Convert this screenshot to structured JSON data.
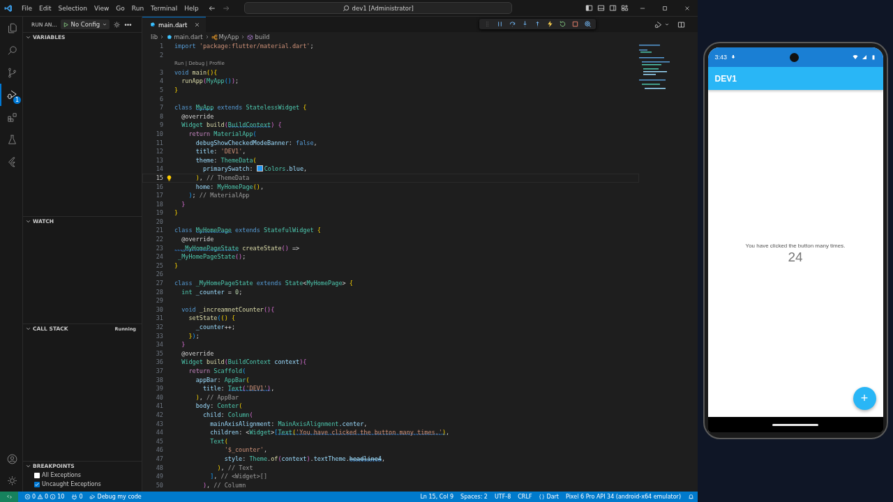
{
  "title_bar": {
    "menu": [
      "File",
      "Edit",
      "Selection",
      "View",
      "Go",
      "Run",
      "Terminal",
      "Help"
    ],
    "command_center": "dev1 [Administrator]"
  },
  "activity_bar": {
    "items": [
      {
        "kind": "explorer",
        "selected": false
      },
      {
        "kind": "search",
        "selected": false
      },
      {
        "kind": "source-control",
        "selected": false
      },
      {
        "kind": "debug",
        "selected": true,
        "badge": "1"
      },
      {
        "kind": "extensions",
        "selected": false
      },
      {
        "kind": "testing",
        "selected": false
      },
      {
        "kind": "flutter",
        "selected": false
      }
    ],
    "bottom": [
      {
        "kind": "account"
      },
      {
        "kind": "settings"
      }
    ]
  },
  "run_panel": {
    "title": "RUN AN...",
    "config": "No Config",
    "sections": [
      {
        "title": "VARIABLES",
        "expanded": true
      },
      {
        "title": "WATCH",
        "expanded": true
      },
      {
        "title": "CALL STACK",
        "expanded": true,
        "status": "Running"
      },
      {
        "title": "BREAKPOINTS",
        "expanded": true,
        "items": [
          {
            "label": "All Exceptions",
            "checked": false
          },
          {
            "label": "Uncaught Exceptions",
            "checked": true
          }
        ]
      }
    ]
  },
  "editor": {
    "tabs": [
      {
        "label": "main.dart",
        "selected": true
      }
    ],
    "breadcrumbs": [
      {
        "kind": "folder",
        "text": "lib"
      },
      {
        "kind": "file",
        "text": "main.dart"
      },
      {
        "kind": "class",
        "text": "MyApp"
      },
      {
        "kind": "method",
        "text": "build"
      }
    ],
    "lines": [
      {
        "n": "1",
        "current": false,
        "tokens": [
          {
            "text": "import ",
            "kind": "kw"
          },
          {
            "text": "'package:flutter/material.dart'",
            "kind": "str"
          },
          {
            "text": ";",
            "kind": "p"
          }
        ]
      },
      {
        "n": "2",
        "current": false
      },
      {
        "n": "3",
        "current": false,
        "codelens": "Run | Debug | Profile",
        "tokens": [
          {
            "text": "void ",
            "kind": "kw"
          },
          {
            "text": "main",
            "kind": "fn"
          },
          {
            "text": "(){",
            "kind": "b1"
          }
        ]
      },
      {
        "n": "4",
        "current": false,
        "tokens": [
          {
            "text": "  runApp",
            "kind": "fn"
          },
          {
            "text": "(",
            "kind": "b2"
          },
          {
            "text": "MyApp",
            "kind": "type"
          },
          {
            "text": "()",
            "kind": "b3"
          },
          {
            "text": ")",
            "kind": "b2"
          },
          {
            "text": ";",
            "kind": "p"
          }
        ]
      },
      {
        "n": "5",
        "current": false,
        "tokens": [
          {
            "text": "}",
            "kind": "b1"
          }
        ]
      },
      {
        "n": "6",
        "current": false
      },
      {
        "n": "7",
        "current": false,
        "tokens": [
          {
            "text": "class ",
            "kind": "kw"
          },
          {
            "text": "MyApp",
            "kind": "type",
            "squiggle": true
          },
          {
            "text": " extends ",
            "kind": "kw"
          },
          {
            "text": "StatelessWidget",
            "kind": "type"
          },
          {
            "text": " {",
            "kind": "b1"
          }
        ]
      },
      {
        "n": "8",
        "current": false,
        "tokens": [
          {
            "text": "  @override",
            "kind": "ann"
          }
        ]
      },
      {
        "n": "9",
        "current": false,
        "tokens": [
          {
            "text": "  Widget",
            "kind": "type"
          },
          {
            "text": " build",
            "kind": "fn"
          },
          {
            "text": "(",
            "kind": "b2"
          },
          {
            "text": "BuildContext",
            "kind": "type",
            "squiggle": true
          },
          {
            "text": ")",
            "kind": "b2"
          },
          {
            "text": " {",
            "kind": "b2"
          }
        ]
      },
      {
        "n": "10",
        "current": false,
        "tokens": [
          {
            "text": "    return ",
            "kind": "ctl"
          },
          {
            "text": "MaterialApp",
            "kind": "type"
          },
          {
            "text": "(",
            "kind": "b3"
          }
        ]
      },
      {
        "n": "11",
        "current": false,
        "tokens": [
          {
            "text": "      debugShowCheckedModeBanner",
            "kind": "var"
          },
          {
            "text": ": ",
            "kind": "p"
          },
          {
            "text": "false",
            "kind": "kw"
          },
          {
            "text": ",",
            "kind": "p"
          }
        ]
      },
      {
        "n": "12",
        "current": false,
        "tokens": [
          {
            "text": "      title",
            "kind": "var"
          },
          {
            "text": ": ",
            "kind": "p"
          },
          {
            "text": "'DEV1'",
            "kind": "str"
          },
          {
            "text": ",",
            "kind": "p"
          }
        ]
      },
      {
        "n": "13",
        "current": false,
        "tokens": [
          {
            "text": "      theme",
            "kind": "var"
          },
          {
            "text": ": ",
            "kind": "p"
          },
          {
            "text": "ThemeData",
            "kind": "type"
          },
          {
            "text": "(",
            "kind": "b1"
          }
        ]
      },
      {
        "n": "14",
        "current": false,
        "tokens": [
          {
            "text": "        primarySwatch",
            "kind": "var"
          },
          {
            "text": ": ",
            "kind": "p"
          },
          {
            "text": "Colors",
            "kind": "type",
            "color": "#2196f3"
          },
          {
            "text": ".blue",
            "kind": "var"
          },
          {
            "text": ",",
            "kind": "p"
          }
        ]
      },
      {
        "n": "15",
        "current": true,
        "tokens": [
          {
            "text": "      )",
            "kind": "b1"
          },
          {
            "text": ", ",
            "kind": "p"
          },
          {
            "text": "// ThemeData",
            "kind": "cmt"
          }
        ]
      },
      {
        "n": "16",
        "current": false,
        "tokens": [
          {
            "text": "      home",
            "kind": "var"
          },
          {
            "text": ": ",
            "kind": "p"
          },
          {
            "text": "MyHomePage",
            "kind": "type"
          },
          {
            "text": "()",
            "kind": "b1"
          },
          {
            "text": ",",
            "kind": "p"
          }
        ]
      },
      {
        "n": "17",
        "current": false,
        "tokens": [
          {
            "text": "    )",
            "kind": "b3"
          },
          {
            "text": "; ",
            "kind": "p"
          },
          {
            "text": "// MaterialApp",
            "kind": "cmt"
          }
        ]
      },
      {
        "n": "18",
        "current": false,
        "tokens": [
          {
            "text": "  }",
            "kind": "b2"
          }
        ]
      },
      {
        "n": "19",
        "current": false,
        "tokens": [
          {
            "text": "}",
            "kind": "b1"
          }
        ]
      },
      {
        "n": "20",
        "current": false
      },
      {
        "n": "21",
        "current": false,
        "tokens": [
          {
            "text": "class ",
            "kind": "kw"
          },
          {
            "text": "MyHomePage",
            "kind": "type",
            "squiggle": true
          },
          {
            "text": " extends ",
            "kind": "kw"
          },
          {
            "text": "StatefulWidget",
            "kind": "type"
          },
          {
            "text": " {",
            "kind": "b1"
          }
        ]
      },
      {
        "n": "22",
        "current": false,
        "tokens": [
          {
            "text": "  @override",
            "kind": "ann"
          }
        ]
      },
      {
        "n": "23",
        "current": false,
        "tokens": [
          {
            "text": "  _MyHomePageState",
            "kind": "type",
            "squiggle": true
          },
          {
            "text": " createState",
            "kind": "fn"
          },
          {
            "text": "()",
            "kind": "b2"
          },
          {
            "text": " =>",
            "kind": "p"
          }
        ]
      },
      {
        "n": "24",
        "current": false,
        "tokens": [
          {
            "text": " _MyHomePageState",
            "kind": "type"
          },
          {
            "text": "()",
            "kind": "b2"
          },
          {
            "text": ";",
            "kind": "p"
          }
        ]
      },
      {
        "n": "25",
        "current": false,
        "tokens": [
          {
            "text": "}",
            "kind": "b1"
          }
        ]
      },
      {
        "n": "26",
        "current": false
      },
      {
        "n": "27",
        "current": false,
        "tokens": [
          {
            "text": "class ",
            "kind": "kw"
          },
          {
            "text": "_MyHomePageState",
            "kind": "type"
          },
          {
            "text": " extends ",
            "kind": "kw"
          },
          {
            "text": "State",
            "kind": "type"
          },
          {
            "text": "<",
            "kind": "p"
          },
          {
            "text": "MyHomePage",
            "kind": "type"
          },
          {
            "text": ">",
            "kind": "p"
          },
          {
            "text": " {",
            "kind": "b1"
          }
        ]
      },
      {
        "n": "28",
        "current": false,
        "tokens": [
          {
            "text": "  int",
            "kind": "type"
          },
          {
            "text": " _counter",
            "kind": "var"
          },
          {
            "text": " = ",
            "kind": "p"
          },
          {
            "text": "0",
            "kind": "num"
          },
          {
            "text": ";",
            "kind": "p"
          }
        ]
      },
      {
        "n": "29",
        "current": false
      },
      {
        "n": "30",
        "current": false,
        "tokens": [
          {
            "text": "  void ",
            "kind": "kw"
          },
          {
            "text": "_increamnetCounter",
            "kind": "fn"
          },
          {
            "text": "()",
            "kind": "b2"
          },
          {
            "text": "{",
            "kind": "b2"
          }
        ]
      },
      {
        "n": "31",
        "current": false,
        "tokens": [
          {
            "text": "    setState",
            "kind": "fn"
          },
          {
            "text": "(",
            "kind": "b3"
          },
          {
            "text": "()",
            "kind": "b1"
          },
          {
            "text": " {",
            "kind": "b1"
          }
        ]
      },
      {
        "n": "32",
        "current": false,
        "tokens": [
          {
            "text": "      _counter",
            "kind": "var"
          },
          {
            "text": "++;",
            "kind": "p"
          }
        ]
      },
      {
        "n": "33",
        "current": false,
        "tokens": [
          {
            "text": "    }",
            "kind": "b1"
          },
          {
            "text": ")",
            "kind": "b3"
          },
          {
            "text": ";",
            "kind": "p"
          }
        ]
      },
      {
        "n": "34",
        "current": false,
        "tokens": [
          {
            "text": "  }",
            "kind": "b2"
          }
        ]
      },
      {
        "n": "35",
        "current": false,
        "tokens": [
          {
            "text": "  @override",
            "kind": "ann"
          }
        ]
      },
      {
        "n": "36",
        "current": false,
        "tokens": [
          {
            "text": "  Widget",
            "kind": "type"
          },
          {
            "text": " build",
            "kind": "fn"
          },
          {
            "text": "(",
            "kind": "b2"
          },
          {
            "text": "BuildContext",
            "kind": "type"
          },
          {
            "text": " context",
            "kind": "var"
          },
          {
            "text": ")",
            "kind": "b2"
          },
          {
            "text": "{",
            "kind": "b2"
          }
        ]
      },
      {
        "n": "37",
        "current": false,
        "tokens": [
          {
            "text": "    return ",
            "kind": "ctl"
          },
          {
            "text": "Scaffold",
            "kind": "type"
          },
          {
            "text": "(",
            "kind": "b3"
          }
        ]
      },
      {
        "n": "38",
        "current": false,
        "tokens": [
          {
            "text": "      appBar",
            "kind": "var"
          },
          {
            "text": ": ",
            "kind": "p"
          },
          {
            "text": "AppBar",
            "kind": "type"
          },
          {
            "text": "(",
            "kind": "b1"
          }
        ]
      },
      {
        "n": "39",
        "current": false,
        "tokens": [
          {
            "text": "        title",
            "kind": "var"
          },
          {
            "text": ": ",
            "kind": "p"
          },
          {
            "text": "Text",
            "kind": "type",
            "squiggle": true
          },
          {
            "text": "(",
            "kind": "b2",
            "squiggle": true
          },
          {
            "text": "'DEV1'",
            "kind": "str",
            "squiggle": true
          },
          {
            "text": ")",
            "kind": "b2",
            "squiggle": true
          },
          {
            "text": ",",
            "kind": "p"
          }
        ]
      },
      {
        "n": "40",
        "current": false,
        "tokens": [
          {
            "text": "      )",
            "kind": "b1"
          },
          {
            "text": ", ",
            "kind": "p"
          },
          {
            "text": "// AppBar",
            "kind": "cmt"
          }
        ]
      },
      {
        "n": "41",
        "current": false,
        "tokens": [
          {
            "text": "      body",
            "kind": "var"
          },
          {
            "text": ": ",
            "kind": "p"
          },
          {
            "text": "Center",
            "kind": "type"
          },
          {
            "text": "(",
            "kind": "b1"
          }
        ]
      },
      {
        "n": "42",
        "current": false,
        "tokens": [
          {
            "text": "        child",
            "kind": "var"
          },
          {
            "text": ": ",
            "kind": "p"
          },
          {
            "text": "Column",
            "kind": "type"
          },
          {
            "text": "(",
            "kind": "b2"
          }
        ]
      },
      {
        "n": "43",
        "current": false,
        "tokens": [
          {
            "text": "          mainAxisAlignment",
            "kind": "var"
          },
          {
            "text": ": ",
            "kind": "p"
          },
          {
            "text": "MainAxisAlignment",
            "kind": "type"
          },
          {
            "text": ".center",
            "kind": "var"
          },
          {
            "text": ",",
            "kind": "p"
          }
        ]
      },
      {
        "n": "44",
        "current": false,
        "tokens": [
          {
            "text": "          children",
            "kind": "var"
          },
          {
            "text": ": <",
            "kind": "p"
          },
          {
            "text": "Widget",
            "kind": "type"
          },
          {
            "text": ">",
            "kind": "p"
          },
          {
            "text": "[",
            "kind": "b3"
          },
          {
            "text": "Text",
            "kind": "type",
            "squiggle": true
          },
          {
            "text": "(",
            "kind": "b1",
            "squiggle": true
          },
          {
            "text": "'You have clicked the button many times.'",
            "kind": "str",
            "squiggle": true
          },
          {
            "text": ")",
            "kind": "b1",
            "squiggle": true
          },
          {
            "text": ",",
            "kind": "p"
          }
        ]
      },
      {
        "n": "45",
        "current": false,
        "tokens": [
          {
            "text": "          Text",
            "kind": "type"
          },
          {
            "text": "(",
            "kind": "b1"
          }
        ]
      },
      {
        "n": "46",
        "current": false,
        "tokens": [
          {
            "text": "              '$_counter'",
            "kind": "str"
          },
          {
            "text": ",",
            "kind": "p"
          }
        ]
      },
      {
        "n": "47",
        "current": false,
        "tokens": [
          {
            "text": "              style",
            "kind": "var"
          },
          {
            "text": ": ",
            "kind": "p"
          },
          {
            "text": "Theme",
            "kind": "type"
          },
          {
            "text": ".",
            "kind": "p"
          },
          {
            "text": "of",
            "kind": "fn"
          },
          {
            "text": "(",
            "kind": "b2"
          },
          {
            "text": "context",
            "kind": "var"
          },
          {
            "text": ")",
            "kind": "b2"
          },
          {
            "text": ".",
            "kind": "p"
          },
          {
            "text": "textTheme",
            "kind": "var"
          },
          {
            "text": ".",
            "kind": "p"
          },
          {
            "text": "headline4",
            "kind": "var",
            "squiggle": true,
            "deprecated": true
          },
          {
            "text": ",",
            "kind": "p"
          }
        ]
      },
      {
        "n": "48",
        "current": false,
        "tokens": [
          {
            "text": "            )",
            "kind": "b1"
          },
          {
            "text": ", ",
            "kind": "p"
          },
          {
            "text": "// Text",
            "kind": "cmt"
          }
        ]
      },
      {
        "n": "49",
        "current": false,
        "tokens": [
          {
            "text": "          ]",
            "kind": "b3"
          },
          {
            "text": ", ",
            "kind": "p"
          },
          {
            "text": "// <Widget>[]",
            "kind": "cmt"
          }
        ]
      },
      {
        "n": "50",
        "current": false,
        "tokens": [
          {
            "text": "        )",
            "kind": "b2"
          },
          {
            "text": ", ",
            "kind": "p"
          },
          {
            "text": "// Column",
            "kind": "cmt"
          }
        ]
      }
    ]
  },
  "status_bar": {
    "left": [
      {
        "kind": "remote"
      },
      {
        "kind": "problems",
        "errors": "0",
        "warnings": "0",
        "info": "10"
      },
      {
        "kind": "ports",
        "text": "0"
      },
      {
        "kind": "launch",
        "text": "Debug my code"
      }
    ],
    "right": [
      {
        "kind": "text",
        "text": "Ln 15, Col 9"
      },
      {
        "kind": "text",
        "text": "Spaces: 2"
      },
      {
        "kind": "text",
        "text": "UTF-8"
      },
      {
        "kind": "text",
        "text": "CRLF"
      },
      {
        "kind": "language",
        "text": "Dart"
      },
      {
        "kind": "text",
        "text": "Pixel 6 Pro API 34 (android-x64 emulator)"
      },
      {
        "kind": "bell"
      }
    ]
  },
  "emulator": {
    "time": "3:43",
    "app_title": "DEV1",
    "message": "You have clicked the button many times.",
    "counter": "24",
    "fab": "+"
  }
}
